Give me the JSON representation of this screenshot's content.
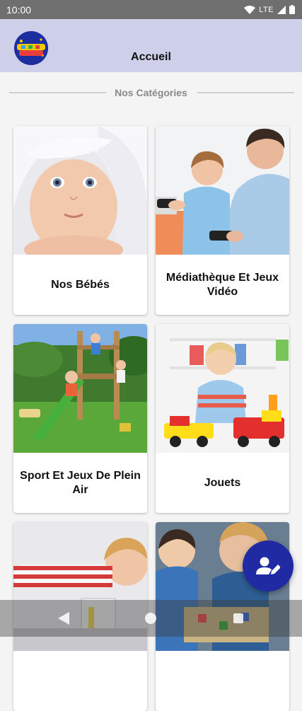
{
  "status_bar": {
    "time": "10:00",
    "network": "LTE"
  },
  "app_bar": {
    "title": "Accueil",
    "logo_icon": "toy-store-logo"
  },
  "section": {
    "title": "Nos Catégories"
  },
  "categories": [
    {
      "label": "Nos Bébés",
      "image": "baby-in-towel-photo"
    },
    {
      "label": "Médiathèque Et Jeux Vidéo",
      "image": "father-son-gaming-photo"
    },
    {
      "label": "Sport Et Jeux De Plein Air",
      "image": "kids-slide-playground-photo"
    },
    {
      "label": "Jouets",
      "image": "toddler-toy-cars-photo"
    },
    {
      "label": "",
      "image": "boy-building-blocks-photo"
    },
    {
      "label": "",
      "image": "family-board-game-photo"
    }
  ],
  "fab": {
    "icon": "user-edit-icon"
  },
  "colors": {
    "app_bar": "#cdd0e8",
    "accent": "#1f2aa3",
    "status_bar": "#6f6f6f"
  }
}
